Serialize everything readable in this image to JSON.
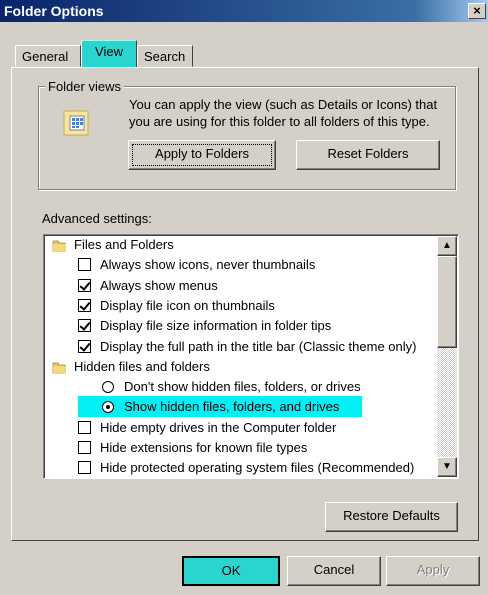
{
  "window": {
    "title": "Folder Options",
    "close_glyph": "×"
  },
  "tabs": [
    {
      "label": "General"
    },
    {
      "label": "View",
      "active": true
    },
    {
      "label": "Search"
    }
  ],
  "folder_views": {
    "legend": "Folder views",
    "description_line1": "You can apply the view (such as Details or Icons) that",
    "description_line2": "you are using for this folder to all folders of this type.",
    "apply_button": "Apply to Folders",
    "reset_button": "Reset Folders"
  },
  "advanced": {
    "label": "Advanced settings:",
    "items": [
      {
        "type": "folder",
        "text": "Files and Folders"
      },
      {
        "type": "checkbox",
        "checked": false,
        "text": "Always show icons, never thumbnails"
      },
      {
        "type": "checkbox",
        "checked": true,
        "text": "Always show menus"
      },
      {
        "type": "checkbox",
        "checked": true,
        "text": "Display file icon on thumbnails"
      },
      {
        "type": "checkbox",
        "checked": true,
        "text": "Display file size information in folder tips"
      },
      {
        "type": "checkbox",
        "checked": true,
        "text": "Display the full path in the title bar (Classic theme only)"
      },
      {
        "type": "folder",
        "text": "Hidden files and folders"
      },
      {
        "type": "radio",
        "checked": false,
        "text": "Don't show hidden files, folders, or drives"
      },
      {
        "type": "radio",
        "checked": true,
        "text": "Show hidden files, folders, and drives"
      },
      {
        "type": "checkbox",
        "checked": false,
        "text": "Hide empty drives in the Computer folder"
      },
      {
        "type": "checkbox",
        "checked": false,
        "text": "Hide extensions for known file types"
      },
      {
        "type": "checkbox",
        "checked": false,
        "text": "Hide protected operating system files (Recommended)"
      }
    ]
  },
  "restore_defaults_button": "Restore Defaults",
  "footer": {
    "ok": "OK",
    "cancel": "Cancel",
    "apply": "Apply"
  },
  "colors": {
    "highlight": "#00f0f5",
    "tab_active": "#2ad4cf",
    "ok_button": "#2ad4cf",
    "titlebar": "#0a246a"
  }
}
